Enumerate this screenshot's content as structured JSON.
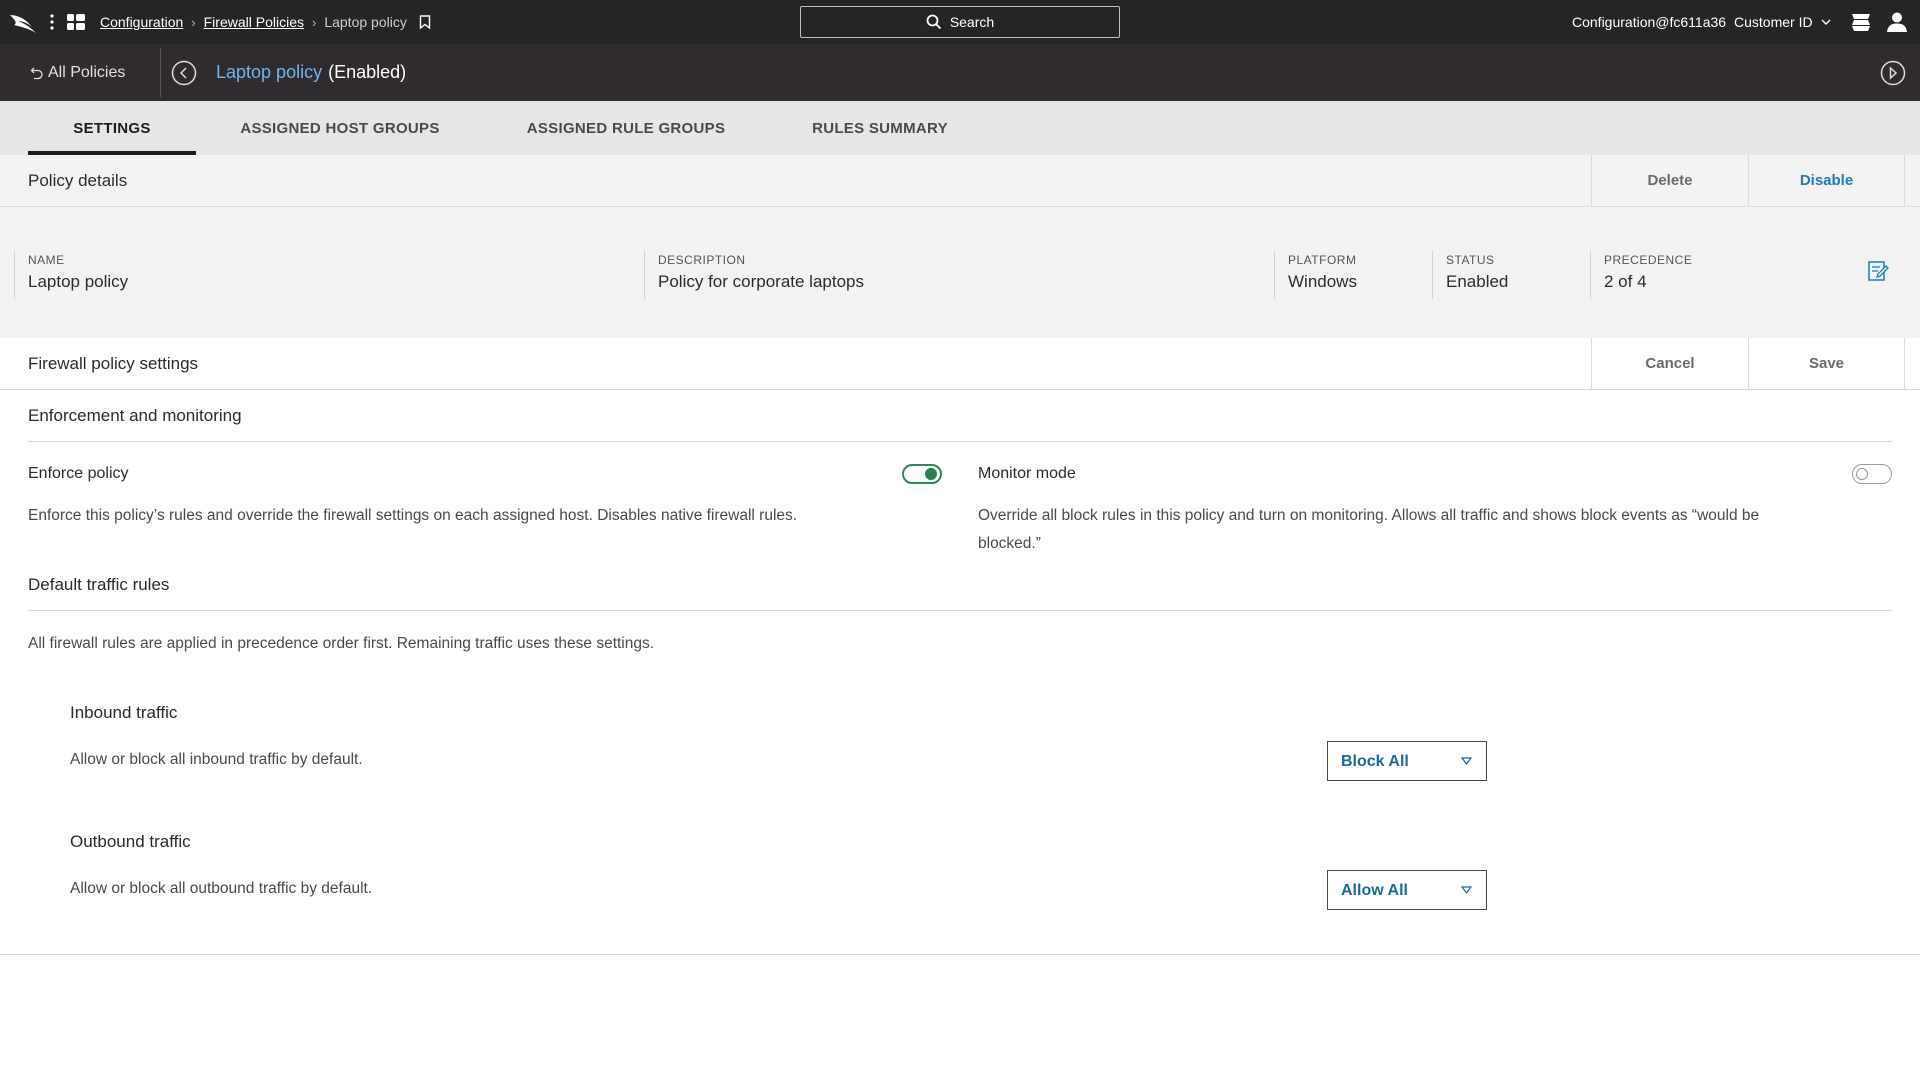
{
  "topbar": {
    "breadcrumbs": [
      "Configuration",
      "Firewall Policies",
      "Laptop policy"
    ],
    "search_label": "Search",
    "user": "Configuration@fc611a36",
    "customer_label": "Customer ID"
  },
  "policy_header": {
    "back_label": "All Policies",
    "policy_name": "Laptop policy",
    "policy_state": "(Enabled)"
  },
  "tabs": [
    {
      "label": "SETTINGS",
      "active": true
    },
    {
      "label": "ASSIGNED HOST GROUPS",
      "active": false
    },
    {
      "label": "ASSIGNED RULE GROUPS",
      "active": false
    },
    {
      "label": "RULES SUMMARY",
      "active": false
    }
  ],
  "policy_details": {
    "title": "Policy details",
    "delete_label": "Delete",
    "disable_label": "Disable",
    "fields": {
      "name": {
        "label": "NAME",
        "value": "Laptop policy"
      },
      "description": {
        "label": "DESCRIPTION",
        "value": "Policy for corporate laptops"
      },
      "platform": {
        "label": "PLATFORM",
        "value": "Windows"
      },
      "status": {
        "label": "STATUS",
        "value": "Enabled"
      },
      "precedence": {
        "label": "PRECEDENCE",
        "value": "2 of 4"
      }
    }
  },
  "firewall_settings": {
    "title": "Firewall policy settings",
    "cancel_label": "Cancel",
    "save_label": "Save",
    "enforcement": {
      "title": "Enforcement and monitoring",
      "enforce_label": "Enforce policy",
      "enforce_on": true,
      "enforce_desc": "Enforce this policy’s rules and override the firewall settings on each assigned host. Disables native firewall rules.",
      "monitor_label": "Monitor mode",
      "monitor_on": false,
      "monitor_desc_line1": "Override all block rules in this policy and turn on monitoring. Allows all traffic and shows block events as “would be",
      "monitor_desc_line2": "blocked.”"
    },
    "default_rules": {
      "title": "Default traffic rules",
      "desc": "All firewall rules are applied in precedence order first. Remaining traffic uses these settings.",
      "inbound": {
        "title": "Inbound traffic",
        "desc": "Allow or block all inbound traffic by default.",
        "value": "Block All"
      },
      "outbound": {
        "title": "Outbound traffic",
        "desc": "Allow or block all outbound traffic by default.",
        "value": "Allow All"
      }
    }
  },
  "colors": {
    "topbar_bg": "#252525",
    "header_bg": "#2f2b2e",
    "link_blue": "#6eb5f0",
    "accent_blue": "#1c7cb5",
    "toggle_green": "#2e7d4f"
  }
}
